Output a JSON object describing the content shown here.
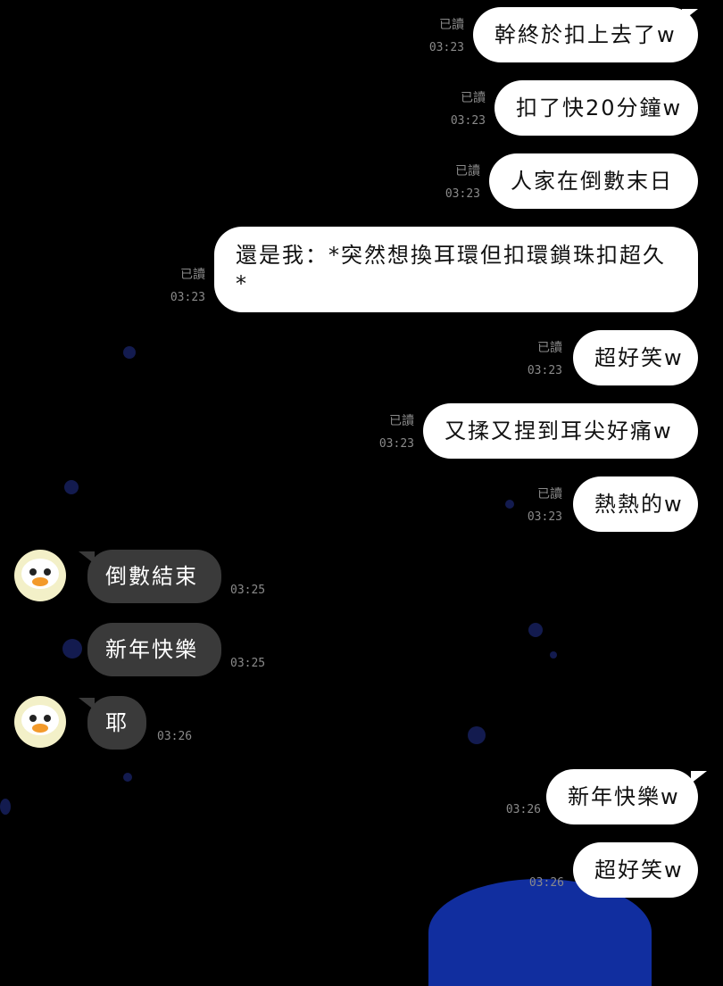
{
  "theme": {
    "outgoing_bg": "#ffffff",
    "incoming_bg": "#3a3a3a",
    "background": "#000000"
  },
  "read_label": "已讀",
  "messages": [
    {
      "dir": "out",
      "text": "幹終於扣上去了w",
      "time": "03:23"
    },
    {
      "dir": "out",
      "text": "扣了快20分鐘w",
      "time": "03:23"
    },
    {
      "dir": "out",
      "text": "人家在倒數末日",
      "time": "03:23"
    },
    {
      "dir": "out",
      "text": "還是我：*突然想換耳環但扣環鎖珠扣超久*",
      "time": "03:23"
    },
    {
      "dir": "out",
      "text": "超好笑w",
      "time": "03:23"
    },
    {
      "dir": "out",
      "text": "又揉又捏到耳尖好痛w",
      "time": "03:23"
    },
    {
      "dir": "out",
      "text": "熱熱的w",
      "time": "03:23"
    },
    {
      "dir": "in",
      "text": "倒數結束",
      "time": "03:25",
      "avatar": "penguin-avatar"
    },
    {
      "dir": "in",
      "text": "新年快樂",
      "time": "03:25"
    },
    {
      "dir": "in",
      "text": "耶",
      "time": "03:26",
      "avatar": "penguin-avatar"
    },
    {
      "dir": "out",
      "text": "新年快樂w",
      "time": "03:26"
    },
    {
      "dir": "out",
      "text": "超好笑w",
      "time": "03:26"
    }
  ]
}
